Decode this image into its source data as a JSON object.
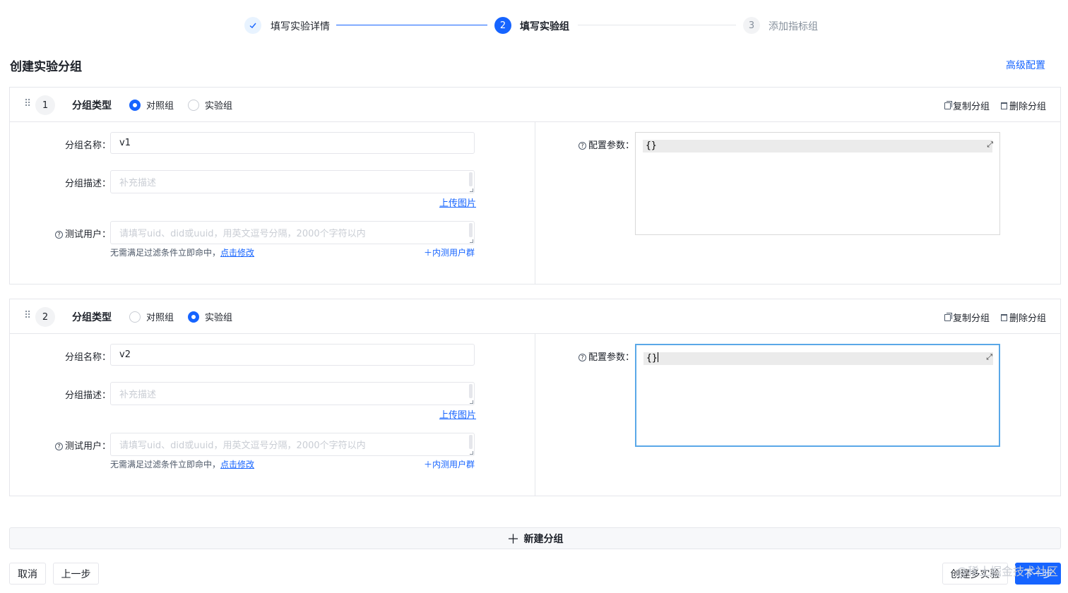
{
  "steps": [
    {
      "label": "填写实验详情",
      "status": "finish",
      "icon": "check-icon"
    },
    {
      "number": "2",
      "label": "填写实验组",
      "status": "process"
    },
    {
      "number": "3",
      "label": "添加指标组",
      "status": "wait"
    }
  ],
  "page_title": "创建实验分组",
  "advanced_config": "高级配置",
  "colors": {
    "primary": "#1664ff",
    "border": "#e5e6eb",
    "focus": "#5aa8e8"
  },
  "labels": {
    "group_type": "分组类型",
    "control": "对照组",
    "experiment": "实验组",
    "copy_group": "复制分组",
    "delete_group": "删除分组",
    "name": "分组名称：",
    "description": "分组描述：",
    "test_users": "测试用户：",
    "config_params": "配置参数：",
    "upload_image": "上传图片",
    "hint_prefix": "无需满足过滤条件立即命中，",
    "hint_link": "点击修改",
    "internal_users": "＋内测用户群",
    "help_glyph": "?"
  },
  "placeholders": {
    "description": "补充描述",
    "test_users": "请填写uid、did或uuid，用英文逗号分隔，2000个字符以内"
  },
  "groups": [
    {
      "index": "1",
      "type": "control",
      "name": "v1",
      "config": "{}"
    },
    {
      "index": "2",
      "type": "experiment",
      "name": "v2",
      "config": "{}"
    }
  ],
  "new_group_label": "新建分组",
  "new_group_icon": "plus-icon",
  "footer": {
    "cancel": "取消",
    "prev": "上一步",
    "create_multi": "创建多实验",
    "next": "下一步"
  },
  "watermark": "@稀土掘金技术社区"
}
